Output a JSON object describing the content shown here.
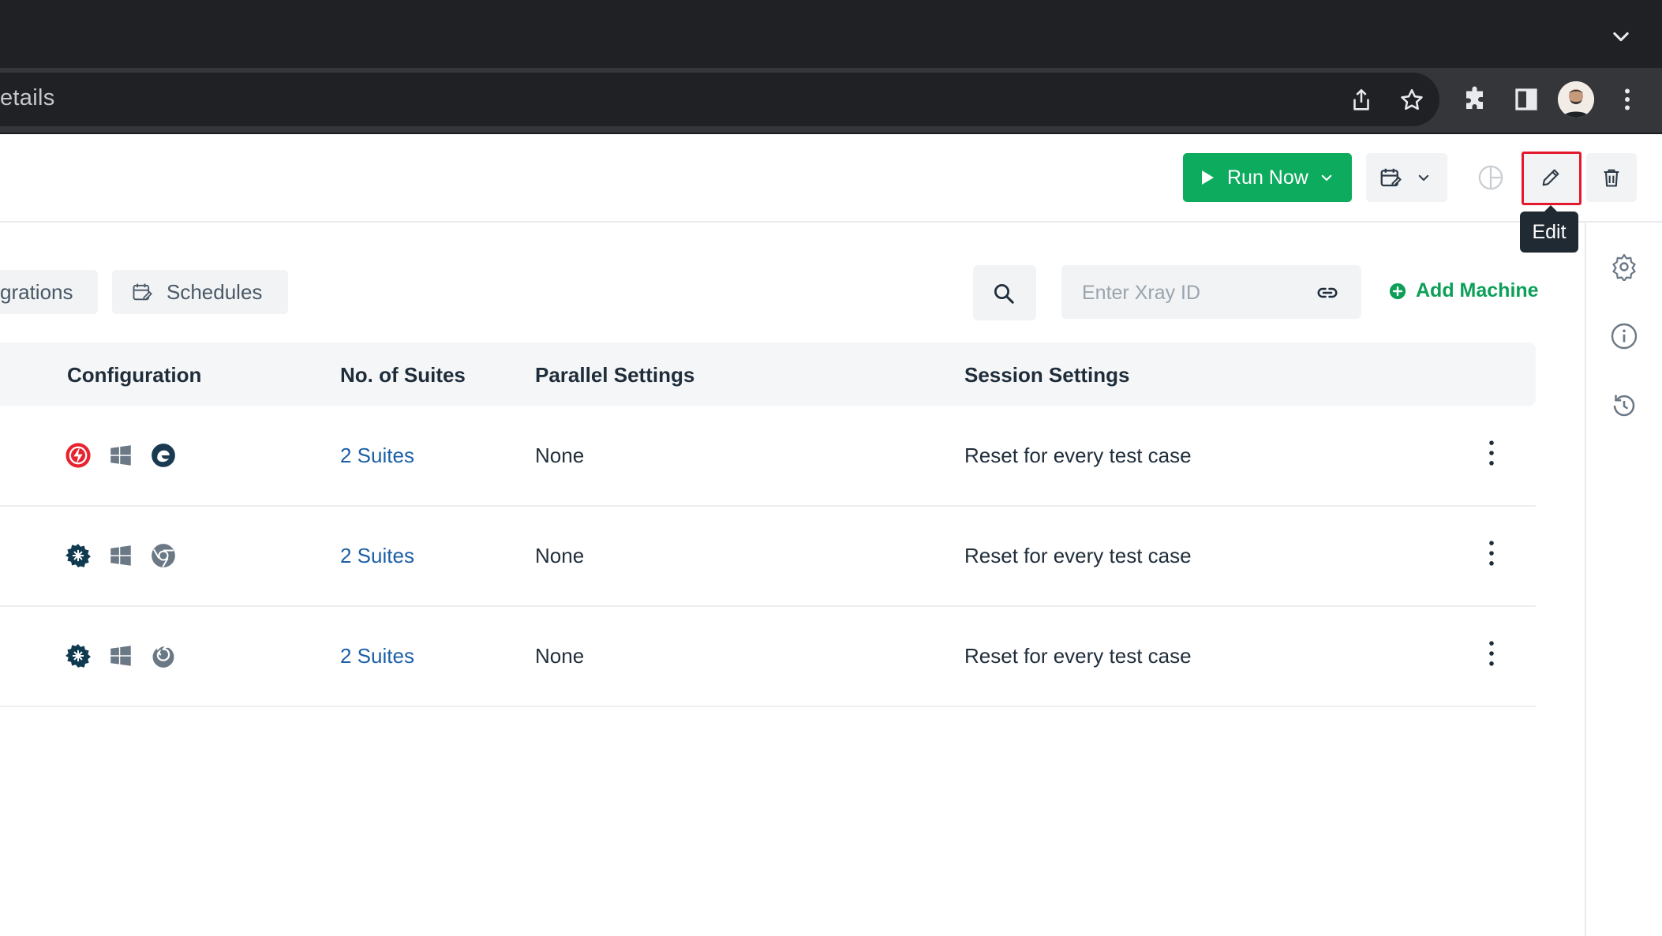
{
  "browser": {
    "omnibox_text": "etails",
    "accent_dark": "#202124"
  },
  "header": {
    "run_now_label": "Run Now",
    "edit_tooltip": "Edit",
    "brand_green": "#0cab5e"
  },
  "tabs": [
    {
      "label": "grations"
    },
    {
      "label": "Schedules"
    }
  ],
  "toolbar": {
    "xray_placeholder": "Enter Xray ID",
    "add_machine_label": "Add Machine"
  },
  "table": {
    "columns": [
      "Configuration",
      "No. of Suites",
      "Parallel Settings",
      "Session Settings"
    ],
    "rows": [
      {
        "icons": [
          "lambda-icon",
          "windows-icon",
          "edge-icon"
        ],
        "suites": "2 Suites",
        "parallel": "None",
        "session": "Reset for every test case"
      },
      {
        "icons": [
          "gear-grid-icon",
          "windows-icon",
          "chrome-icon"
        ],
        "suites": "2 Suites",
        "parallel": "None",
        "session": "Reset for every test case"
      },
      {
        "icons": [
          "gear-grid-icon",
          "windows-icon",
          "firefox-icon"
        ],
        "suites": "2 Suites",
        "parallel": "None",
        "session": "Reset for every test case"
      }
    ]
  }
}
